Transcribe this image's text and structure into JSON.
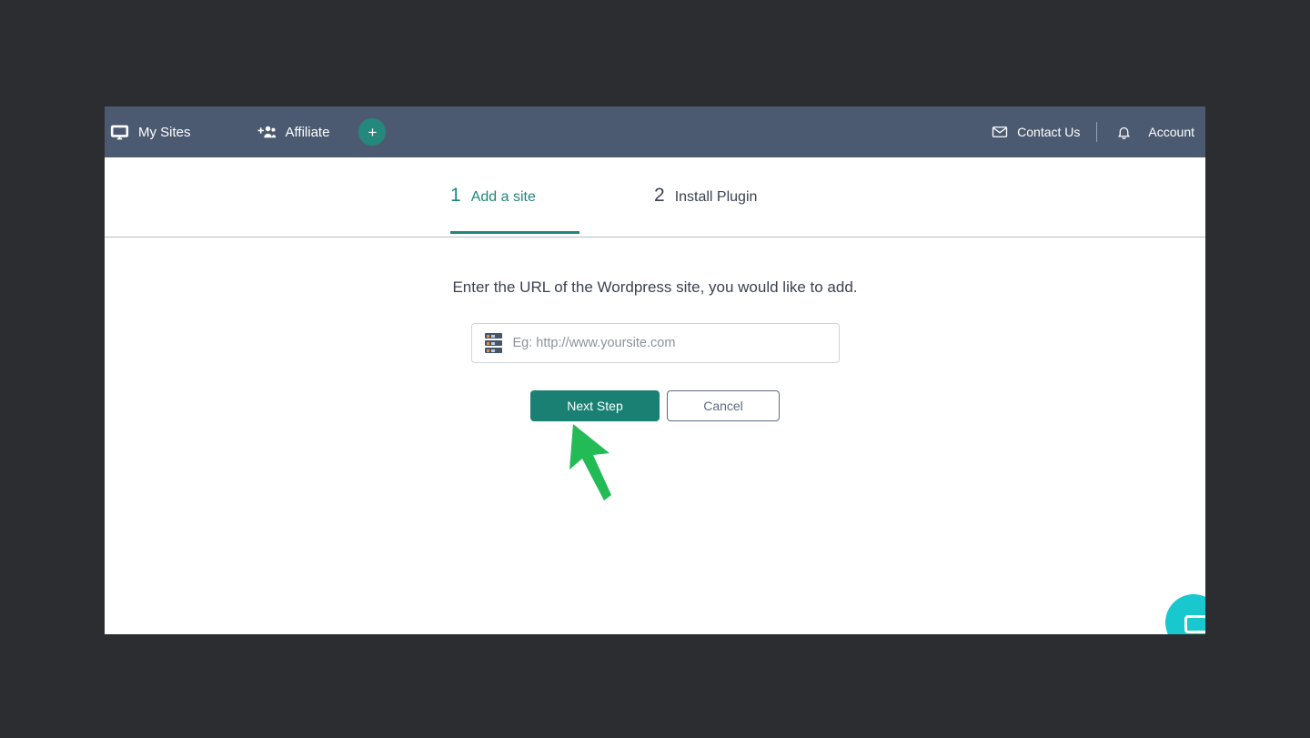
{
  "window": {
    "background_color": "#2b2d31",
    "card_background": "#ffffff"
  },
  "navbar": {
    "background_color": "#4c5a71",
    "left_items": [
      {
        "label": "My Sites",
        "icon": "monitor-icon"
      },
      {
        "label": "Affiliate",
        "icon": "add-users-icon"
      }
    ],
    "add_button": {
      "label": "+",
      "icon": "plus-icon",
      "color": "#24897c"
    },
    "right_items": [
      {
        "label": "Contact Us",
        "icon": "envelope-icon"
      },
      {
        "label": "Account",
        "icon": "bell-icon"
      }
    ],
    "bell_icon": "bell-icon"
  },
  "steps": {
    "active_index": 1,
    "items": [
      {
        "number": "1",
        "label": "Add a site",
        "active": true
      },
      {
        "number": "2",
        "label": "Install Plugin",
        "active": false
      }
    ],
    "active_color": "#21867a",
    "inactive_color": "#3b4350"
  },
  "main": {
    "prompt": "Enter the URL of the Wordpress site, you would like to add.",
    "url_field": {
      "icon": "server-icon",
      "value": "",
      "placeholder": "Eg: http://www.yoursite.com"
    },
    "buttons": {
      "primary": {
        "label": "Next Step",
        "color": "#1a8073"
      },
      "secondary": {
        "label": "Cancel",
        "color": "#5b6b83"
      }
    }
  },
  "chat_widget": {
    "icon": "chat-bubble-icon",
    "color": "#18c8ce"
  },
  "cursor": {
    "icon": "arrow-cursor-icon",
    "color": "#22bb55"
  }
}
